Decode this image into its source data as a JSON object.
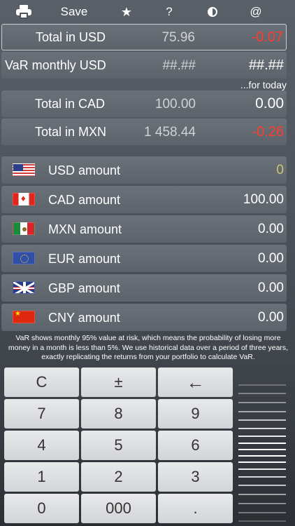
{
  "toolbar": {
    "save_label": "Save",
    "star_label": "★",
    "help_label": "?",
    "email_label": "@"
  },
  "summary": [
    {
      "label": "Total in USD",
      "value": "75.96",
      "change": "-0.07",
      "change_color": "#ff3b30"
    },
    {
      "label": "VaR monthly USD",
      "value": "##.##",
      "change": "##.##",
      "change_color": "#ffffff"
    },
    {
      "label": "Total in CAD",
      "value": "100.00",
      "change": "0.00",
      "change_color": "#ffffff"
    },
    {
      "label": "Total in MXN",
      "value": "1 458.44",
      "change": "-0.26",
      "change_color": "#ff3b30"
    }
  ],
  "for_today_note": "...for today",
  "currencies": [
    {
      "label": "USD amount",
      "value": "0",
      "value_color": "#c8c870",
      "flag": "us-flag-icon"
    },
    {
      "label": "CAD amount",
      "value": "100.00",
      "value_color": "#ffffff",
      "flag": "ca-flag-icon"
    },
    {
      "label": "MXN amount",
      "value": "0.00",
      "value_color": "#ffffff",
      "flag": "mx-flag-icon"
    },
    {
      "label": "EUR amount",
      "value": "0.00",
      "value_color": "#ffffff",
      "flag": "eu-flag-icon"
    },
    {
      "label": "GBP amount",
      "value": "0.00",
      "value_color": "#ffffff",
      "flag": "gb-flag-icon"
    },
    {
      "label": "CNY amount",
      "value": "0.00",
      "value_color": "#ffffff",
      "flag": "cn-flag-icon"
    }
  ],
  "disclaimer": "VaR shows monthly 95% value at risk, which means the probability of losing more money in a month is less than 5%. We use historical data over a period of three years, exactly replicating the returns from your portfolio to calculate VaR.",
  "keypad": {
    "row1": [
      "C",
      "±",
      "←"
    ],
    "row2": [
      "7",
      "8",
      "9"
    ],
    "row3": [
      "4",
      "5",
      "6"
    ],
    "row4": [
      "1",
      "2",
      "3"
    ],
    "row5": [
      "0",
      "000",
      "."
    ]
  }
}
